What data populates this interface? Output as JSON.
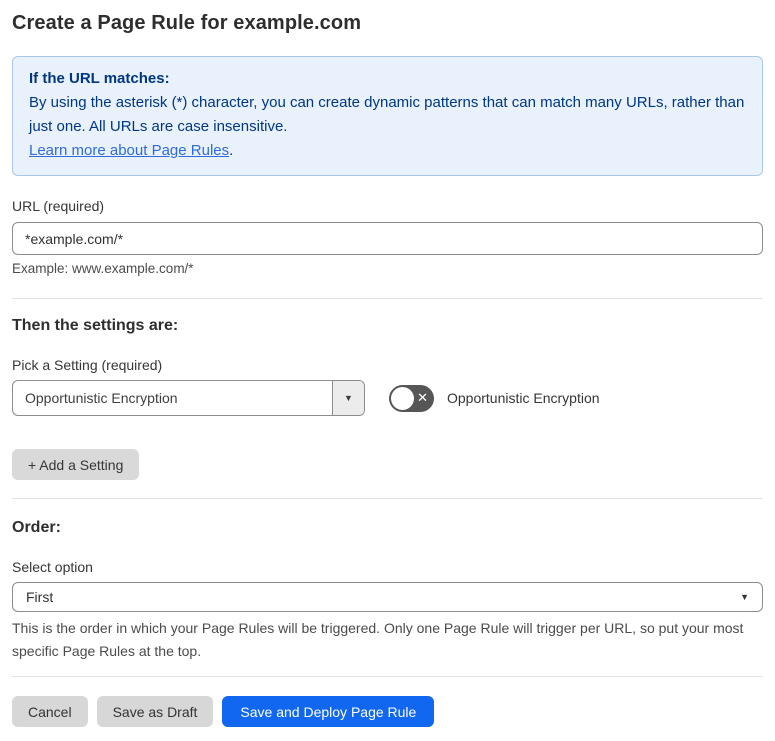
{
  "page": {
    "title": "Create a Page Rule for example.com"
  },
  "info_box": {
    "heading": "If the URL matches:",
    "body": "By using the asterisk (*) character, you can create dynamic patterns that can match many URLs, rather than just one. All URLs are case insensitive.",
    "link_label": "Learn more about Page Rules",
    "link_suffix": "."
  },
  "url_field": {
    "label": "URL (required)",
    "value": "*example.com/*",
    "helper": "Example: www.example.com/*"
  },
  "settings_section": {
    "heading": "Then the settings are:",
    "picker_label": "Pick a Setting (required)",
    "picker_value": "Opportunistic Encryption",
    "picker_caret": "▼",
    "toggle": {
      "state": "off",
      "off_glyph": "✕",
      "label": "Opportunistic Encryption"
    },
    "add_setting_label": "+ Add a Setting"
  },
  "order_section": {
    "heading": "Order:",
    "select_label": "Select option",
    "select_value": "First",
    "select_caret": "▼",
    "helper": "This is the order in which your Page Rules will be triggered. Only one Page Rule will trigger per URL, so put your most specific Page Rules at the top."
  },
  "footer": {
    "cancel_label": "Cancel",
    "save_draft_label": "Save as Draft",
    "save_deploy_label": "Save and Deploy Page Rule"
  },
  "colors": {
    "accent_blue": "#1267f0",
    "info_bg": "#e9f2fc",
    "info_border": "#a9c7e8",
    "info_text": "#003682",
    "link_blue": "#2f6bdb",
    "toggle_off_bg": "#565656",
    "button_gray": "#d7d7d7"
  }
}
